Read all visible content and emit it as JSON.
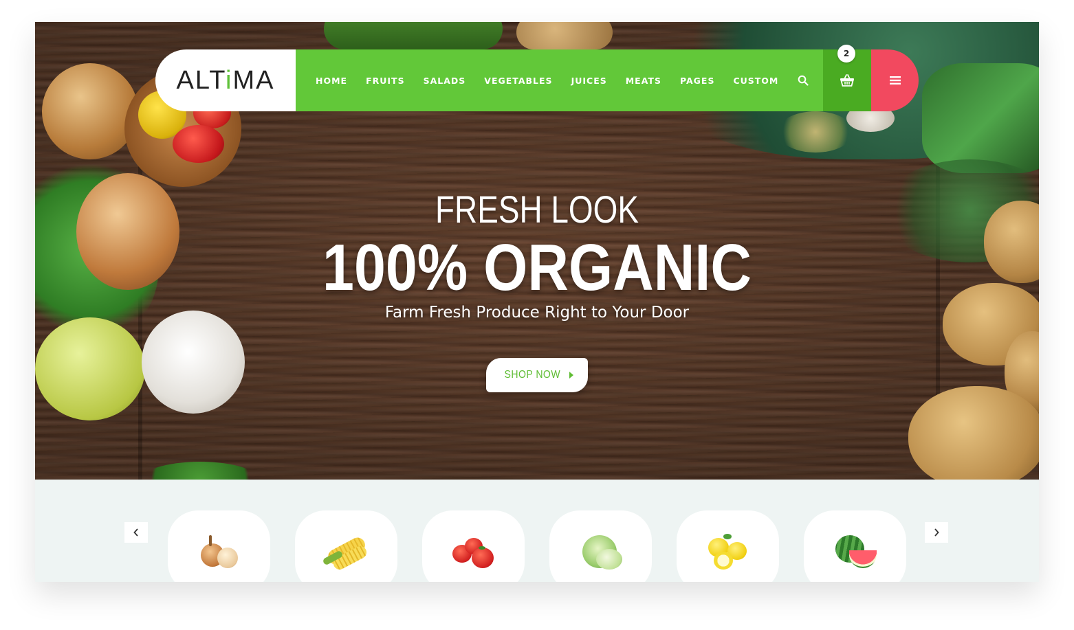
{
  "brand": {
    "logo_parts": [
      "ALT",
      "i",
      "MA"
    ],
    "accent_color": "#62c839",
    "cart_color": "#4aab22",
    "menu_color": "#f2495f"
  },
  "nav": {
    "items": [
      "HOME",
      "FRUITS",
      "SALADS",
      "VEGETABLES",
      "JUICES",
      "MEATS",
      "PAGES",
      "CUSTOM"
    ],
    "search_icon": "search-icon",
    "cart_icon": "basket-icon",
    "cart_count": "2",
    "menu_icon": "hamburger-icon"
  },
  "hero": {
    "eyebrow": "FRESH LOOK",
    "headline": "100% ORGANIC",
    "subline": "Farm Fresh Produce Right to Your Door",
    "cta_label": "SHOP NOW",
    "cta_icon": "caret-right-icon"
  },
  "categories": {
    "prev_icon": "chevron-left-icon",
    "next_icon": "chevron-right-icon",
    "items": [
      {
        "icon": "onion-icon"
      },
      {
        "icon": "corn-icon"
      },
      {
        "icon": "tomato-icon"
      },
      {
        "icon": "cabbage-icon"
      },
      {
        "icon": "lemon-icon"
      },
      {
        "icon": "watermelon-icon"
      }
    ]
  }
}
